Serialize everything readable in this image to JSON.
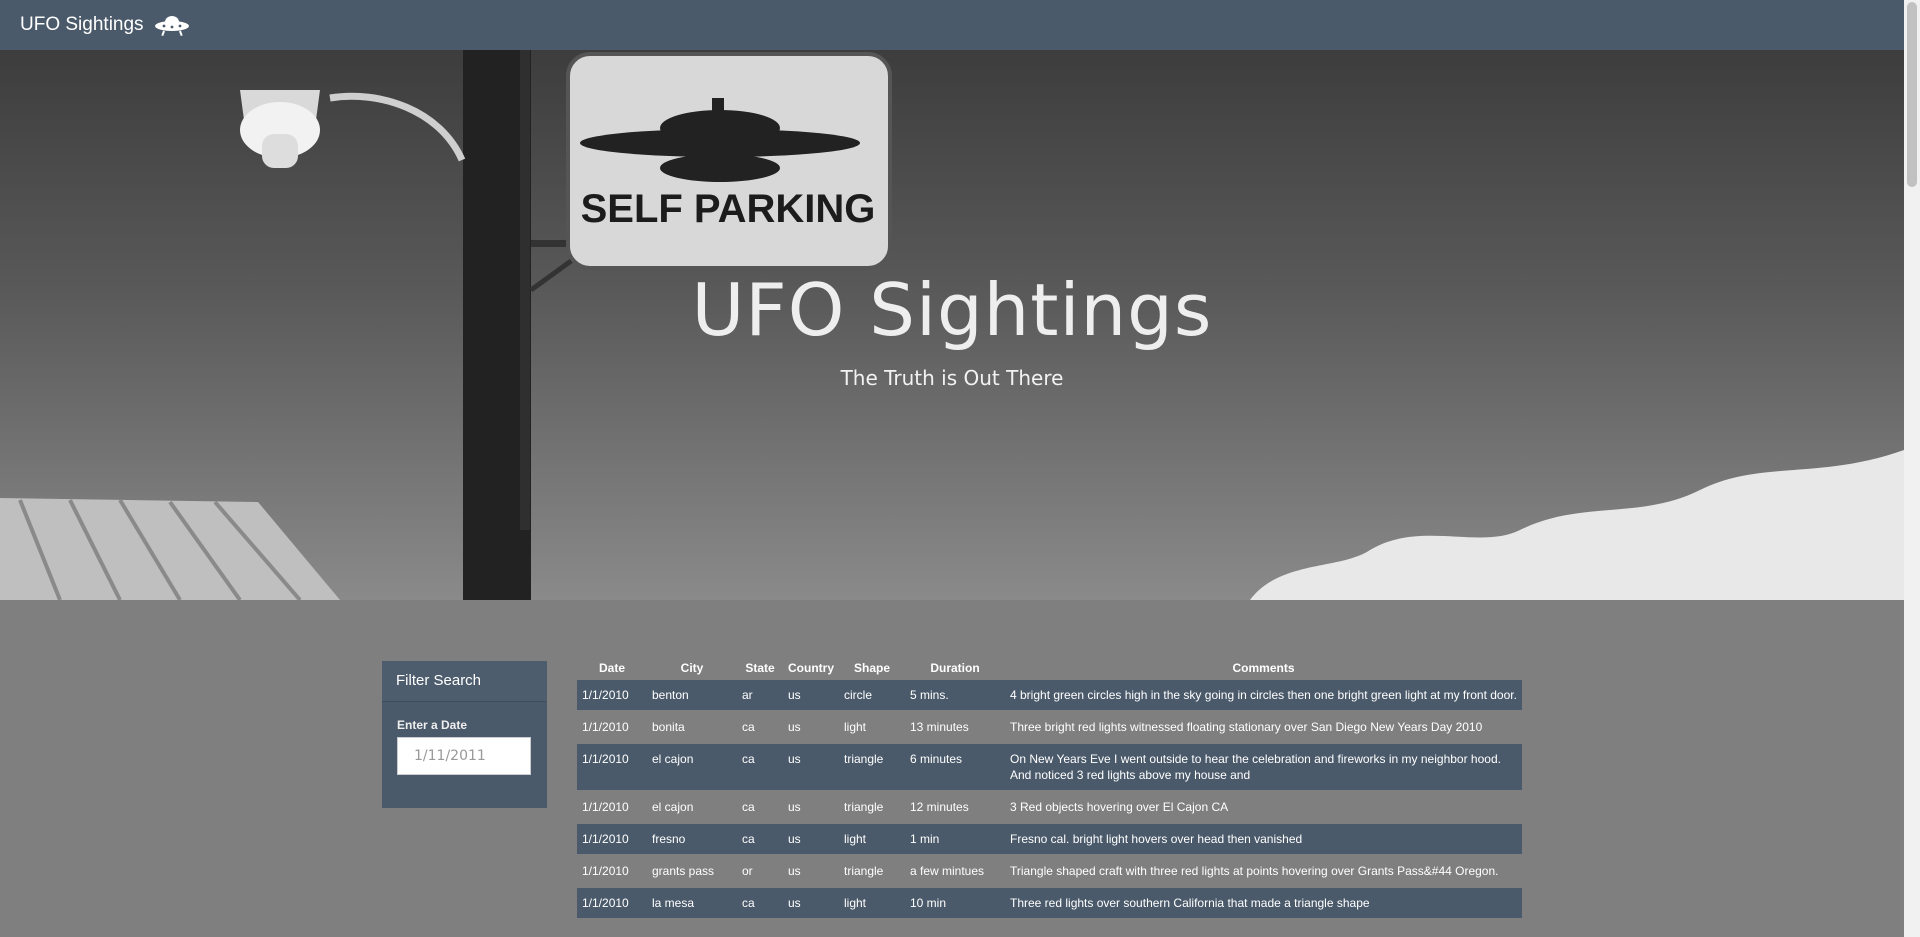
{
  "navbar": {
    "brand": "UFO Sightings",
    "brand_icon": "ufo-icon"
  },
  "hero": {
    "title": "UFO Sightings",
    "subtitle": "The Truth is Out There",
    "sign_text": "SELF PARKING"
  },
  "filter": {
    "heading": "Filter Search",
    "label": "Enter a Date",
    "placeholder": "1/11/2011"
  },
  "table": {
    "headers": [
      "Date",
      "City",
      "State",
      "Country",
      "Shape",
      "Duration",
      "Comments"
    ],
    "rows": [
      [
        "1/1/2010",
        "benton",
        "ar",
        "us",
        "circle",
        "5 mins.",
        "4 bright green circles high in the sky going in circles then one bright green light at my front door."
      ],
      [
        "1/1/2010",
        "bonita",
        "ca",
        "us",
        "light",
        "13 minutes",
        "Three bright red lights witnessed floating stationary over San Diego New Years Day 2010"
      ],
      [
        "1/1/2010",
        "el cajon",
        "ca",
        "us",
        "triangle",
        "6 minutes",
        "On New Years Eve I went outside to hear the celebration and fireworks in my neighbor hood. And noticed 3 red lights above my house and"
      ],
      [
        "1/1/2010",
        "el cajon",
        "ca",
        "us",
        "triangle",
        "12 minutes",
        "3 Red objects hovering over El Cajon CA"
      ],
      [
        "1/1/2010",
        "fresno",
        "ca",
        "us",
        "light",
        "1 min",
        "Fresno cal. bright light hovers over head then vanished"
      ],
      [
        "1/1/2010",
        "grants pass",
        "or",
        "us",
        "triangle",
        "a few mintues",
        "Triangle shaped craft with three red lights at points hovering over Grants Pass&#44 Oregon."
      ],
      [
        "1/1/2010",
        "la mesa",
        "ca",
        "us",
        "light",
        "10 min",
        "Three red lights over southern California that made a triangle shape"
      ]
    ]
  }
}
